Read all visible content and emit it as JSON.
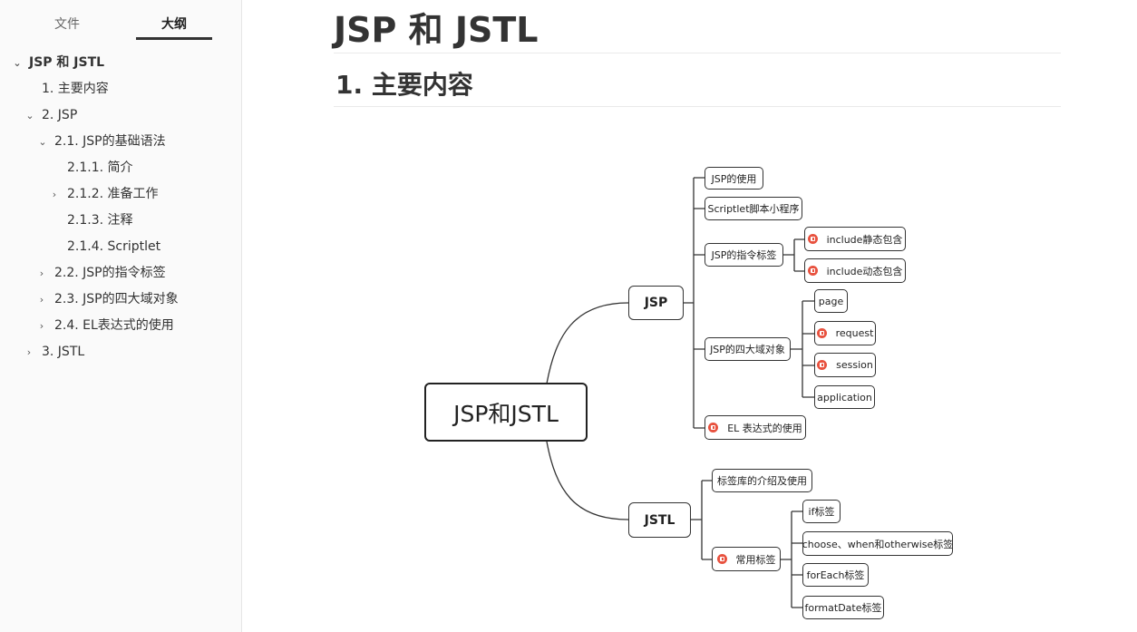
{
  "sidebar": {
    "tabs": [
      {
        "label": "文件"
      },
      {
        "label": "大纲"
      }
    ],
    "toc": [
      {
        "label": "JSP 和 JSTL"
      },
      {
        "label": "1. 主要内容"
      },
      {
        "label": "2. JSP"
      },
      {
        "label": "2.1. JSP的基础语法"
      },
      {
        "label": "2.1.1. 简介"
      },
      {
        "label": "2.1.2. 准备工作"
      },
      {
        "label": "2.1.3. 注释"
      },
      {
        "label": "2.1.4. Scriptlet"
      },
      {
        "label": "2.2. JSP的指令标签"
      },
      {
        "label": "2.3. JSP的四大域对象"
      },
      {
        "label": "2.4. EL表达式的使用"
      },
      {
        "label": "3. JSTL"
      }
    ]
  },
  "main": {
    "title": "JSP 和 JSTL",
    "heading": "1. 主要内容"
  },
  "mindmap": {
    "root": "JSP和JSTL",
    "branches": [
      {
        "label": "JSP"
      },
      {
        "label": "JSTL"
      }
    ],
    "jsp_children": [
      {
        "label": "JSP的使用"
      },
      {
        "label": "Scriptlet脚本小程序"
      },
      {
        "label": "JSP的指令标签"
      },
      {
        "label": "JSP的四大域对象"
      },
      {
        "label": "EL 表达式的使用"
      }
    ],
    "directive_children": [
      {
        "label": "include静态包含"
      },
      {
        "label": "include动态包含"
      }
    ],
    "scope_children": [
      {
        "label": "page"
      },
      {
        "label": "request"
      },
      {
        "label": "session"
      },
      {
        "label": "application"
      }
    ],
    "jstl_children": [
      {
        "label": "标签库的介绍及使用"
      },
      {
        "label": "常用标签"
      }
    ],
    "tag_children": [
      {
        "label": "if标签"
      },
      {
        "label": "choose、when和otherwise标签"
      },
      {
        "label": "forEach标签"
      },
      {
        "label": "formatDate标签"
      }
    ],
    "marker_color": "#e8523f"
  }
}
